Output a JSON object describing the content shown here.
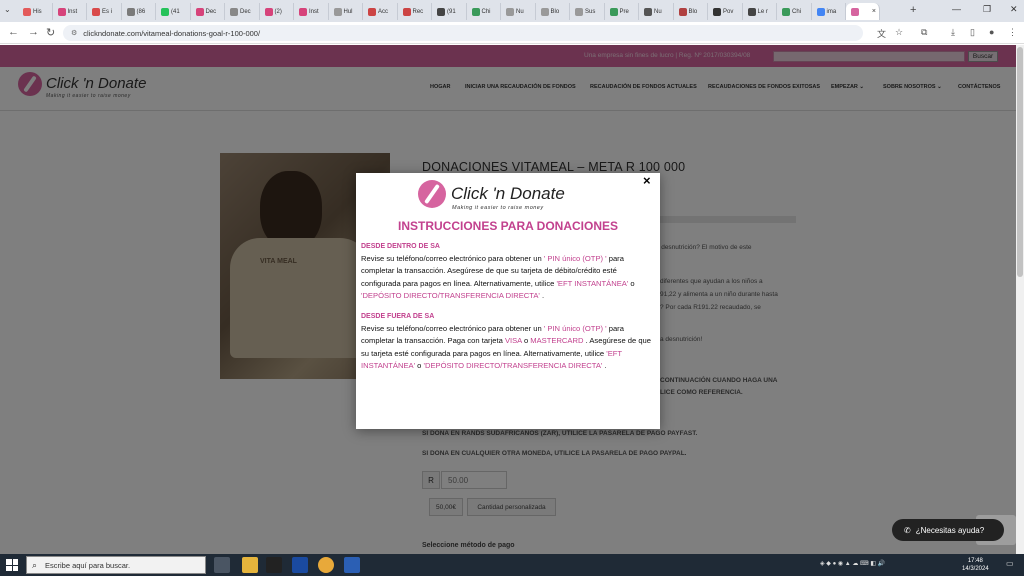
{
  "browser": {
    "tabs": [
      {
        "label": "His",
        "color": "#e35a5a"
      },
      {
        "label": "Inst",
        "color": "#d6437a"
      },
      {
        "label": "Es i",
        "color": "#d94a4a"
      },
      {
        "label": "(86",
        "color": "#7a7a7a"
      },
      {
        "label": "(41",
        "color": "#25c25a"
      },
      {
        "label": "Dec",
        "color": "#d6437a"
      },
      {
        "label": "Dec",
        "color": "#888888"
      },
      {
        "label": "(2)",
        "color": "#d6437a"
      },
      {
        "label": "Inst",
        "color": "#d6437a"
      },
      {
        "label": "Hul",
        "color": "#999999"
      },
      {
        "label": "Acc",
        "color": "#cc4444"
      },
      {
        "label": "Rec",
        "color": "#cc4444"
      },
      {
        "label": "(91",
        "color": "#444444"
      },
      {
        "label": "Chi",
        "color": "#3a9a5a"
      },
      {
        "label": "Nu",
        "color": "#999999"
      },
      {
        "label": "Blo",
        "color": "#999999"
      },
      {
        "label": "Sus",
        "color": "#999999"
      },
      {
        "label": "Pre",
        "color": "#3a9a5a"
      },
      {
        "label": "Nu",
        "color": "#555555"
      },
      {
        "label": "Blo",
        "color": "#b04040"
      },
      {
        "label": "Pov",
        "color": "#333333"
      },
      {
        "label": "Le r",
        "color": "#444444"
      },
      {
        "label": "Chi",
        "color": "#3a9a5a"
      },
      {
        "label": "ima",
        "color": "#4285f4"
      },
      {
        "label": "",
        "color": "#d6649f"
      }
    ],
    "url": "clickndonate.com/vitameal-donations-goal-r-100-000/"
  },
  "site": {
    "registration": "Una empresa sin fines de lucro | Reg. Nº 2017/030394/08",
    "search_button": "Buscar",
    "logo_name": "Click 'n Donate",
    "logo_tagline": "Making it easier to raise money",
    "nav": [
      "HOGAR",
      "INICIAR UNA RECAUDACIÓN DE FONDOS",
      "RECAUDACIÓN DE FONDOS ACTUALES",
      "RECAUDACIONES DE FONDOS EXITOSAS",
      "EMPEZAR",
      "SOBRE NOSOTROS",
      "CONTÁCTENOS"
    ],
    "product_title": "DONACIONES VITAMEAL – META R 100 000",
    "body_lines": [
      "por desnutrición? El motivo de este",
      "diferentes que ayudan a los niños a",
      "91,22 y alimenta a un niño durante hasta",
      "? Por cada R191.22 recaudado, se",
      "a desnutrición!",
      "CONTINUACIÓN CUANDO HAGA UNA",
      "LICE COMO REFERENCIA."
    ],
    "zar_note": "SI DONA EN RANDS SUDAFRICANOS (ZAR), UTILICE LA PASARELA DE PAGO PAYFAST.",
    "other_note": "SI DONA EN CUALQUIER OTRA MONEDA, UTILICE LA PASARELA DE PAGO PAYPAL.",
    "currency_symbol": "R",
    "amount_value": "50.00",
    "preset_amount": "50,00€",
    "custom_amount": "Cantidad personalizada",
    "payment_method": "Seleccione método de pago",
    "whatsapp_label": "¿Necesitas ayuda?"
  },
  "modal": {
    "close": "×",
    "logo_name": "Click 'n Donate",
    "logo_tagline": "Making it easier to raise money",
    "heading": "INSTRUCCIONES PARA DONACIONES",
    "section1_title": "DESDE DENTRO DE SA",
    "s1": {
      "a": "Revise su teléfono/correo electrónico para obtener un ",
      "b": "' PIN único (OTP) '",
      "c": " para completar la transacción. Asegúrese de que su tarjeta de débito/crédito esté configurada para pagos en línea. Alternativamente, utilice ",
      "d": "'EFT INSTANTÁNEA'",
      "e": " o ",
      "f": "'DEPÓSITO DIRECTO/TRANSFERENCIA DIRECTA'",
      "g": " ."
    },
    "section2_title": "DESDE FUERA DE SA",
    "s2": {
      "a": "Revise su teléfono/correo electrónico para obtener un ",
      "b": "' PIN único (OTP) '",
      "c": " para completar la transacción. Paga con tarjeta ",
      "d": "VISA",
      "e": " o ",
      "f": "MASTERCARD",
      "g": " . Asegúrese de que su tarjeta esté configurada para pagos en línea. Alternativamente, utilice ",
      "h": "'EFT INSTANTÁNEA'",
      "i": " o ",
      "j": "'DEPÓSITO DIRECTO/TRANSFERENCIA DIRECTA'",
      "k": " ."
    }
  },
  "taskbar": {
    "search_placeholder": "Escribe aquí para buscar.",
    "time": "17:48",
    "date": "14/3/2024"
  }
}
